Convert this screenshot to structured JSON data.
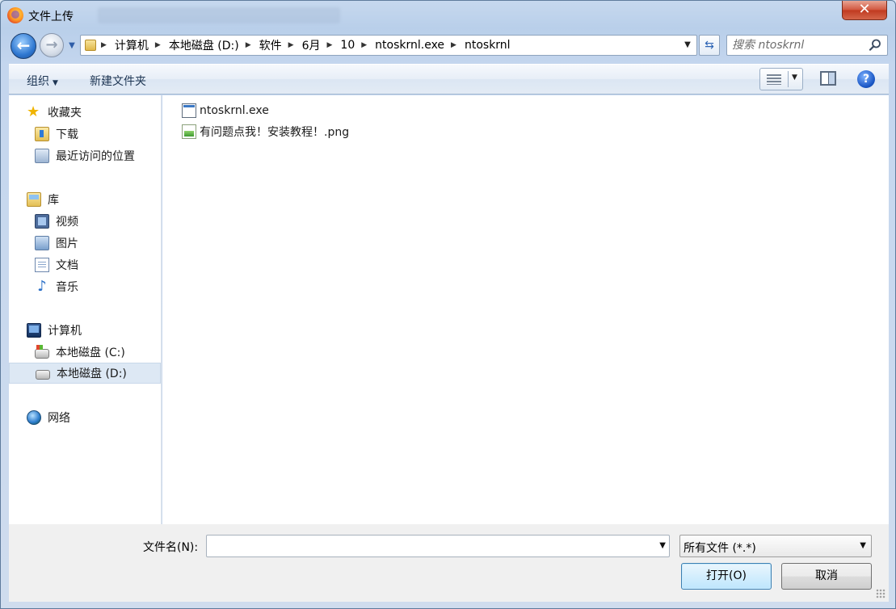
{
  "window": {
    "title": "文件上传",
    "close_symbol": "✕"
  },
  "nav_buttons": {
    "back_symbol": "←",
    "forward_symbol": "→"
  },
  "address": {
    "breadcrumbs": [
      "计算机",
      "本地磁盘 (D:)",
      "软件",
      "6月",
      "10",
      "ntoskrnl.exe",
      "ntoskrnl"
    ]
  },
  "search": {
    "placeholder": "搜索 ntoskrnl"
  },
  "toolbar": {
    "organize_label": "组织",
    "new_folder_label": "新建文件夹",
    "help_symbol": "?"
  },
  "sidebar": {
    "favorites": {
      "label": "收藏夹",
      "items": [
        {
          "label": "下载",
          "icon": "downloads-folder-icon"
        },
        {
          "label": "最近访问的位置",
          "icon": "recent-places-icon"
        }
      ]
    },
    "libraries": {
      "label": "库",
      "items": [
        {
          "label": "视频",
          "icon": "video-library-icon"
        },
        {
          "label": "图片",
          "icon": "pictures-library-icon"
        },
        {
          "label": "文档",
          "icon": "documents-library-icon"
        },
        {
          "label": "音乐",
          "icon": "music-library-icon"
        }
      ]
    },
    "computer": {
      "label": "计算机",
      "items": [
        {
          "label": "本地磁盘 (C:)",
          "icon": "system-drive-icon"
        },
        {
          "label": "本地磁盘 (D:)",
          "icon": "drive-icon",
          "selected": true
        }
      ]
    },
    "network": {
      "label": "网络"
    }
  },
  "files": [
    {
      "name": "ntoskrnl.exe",
      "icon": "exe-file-icon"
    },
    {
      "name": "有问题点我！安装教程！.png",
      "icon": "png-file-icon"
    }
  ],
  "footer": {
    "filename_label": "文件名(N):",
    "filename_value": "",
    "filter_value": "所有文件 (*.*)",
    "open_label": "打开(O)",
    "cancel_label": "取消"
  }
}
